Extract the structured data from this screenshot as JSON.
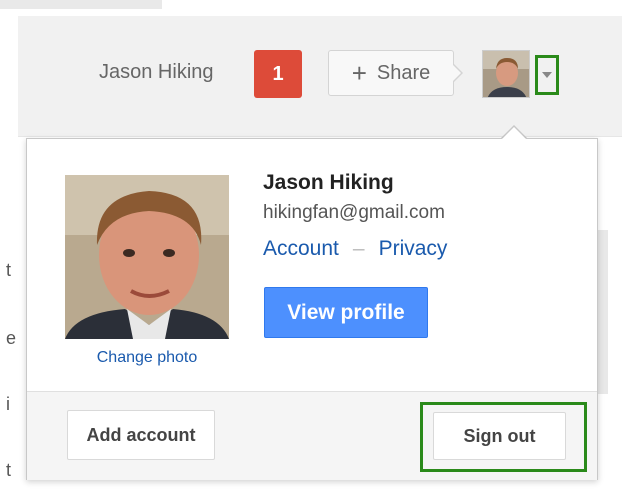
{
  "header": {
    "user_name": "Jason Hiking",
    "notification_count": "1",
    "share_label": "Share",
    "share_icon": "plus-icon",
    "dropdown_icon": "chevron-down-icon"
  },
  "account_popup": {
    "display_name": "Jason Hiking",
    "email": "hikingfan@gmail.com",
    "account_link": "Account",
    "separator": "–",
    "privacy_link": "Privacy",
    "view_profile_label": "View profile",
    "change_photo_label": "Change photo",
    "add_account_label": "Add account",
    "sign_out_label": "Sign out"
  },
  "side_page_fragments": [
    "t",
    "e",
    "i",
    "t"
  ],
  "colors": {
    "notification_red": "#dd4b39",
    "view_profile_blue": "#4d90fe",
    "link_blue": "#1a5aad",
    "highlight_green": "#2a8a1a"
  }
}
